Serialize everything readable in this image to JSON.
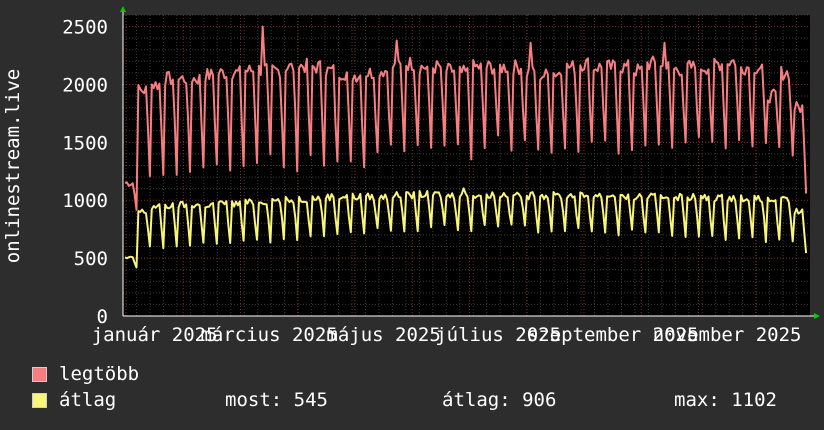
{
  "colors": {
    "background": "#2d2d2d",
    "plot_background": "#000000",
    "grid_minor": "#3a3a3a",
    "grid_major": "#8a2a2a",
    "text": "#ffffff",
    "series_max": "#f77e80",
    "series_avg": "#f8f57a",
    "axis_arrow": "#00cc00"
  },
  "chart_data": {
    "type": "line",
    "ylabel": "onlinestream.live",
    "ylim": [
      0,
      2600
    ],
    "yticks": [
      "0",
      "500",
      "1000",
      "1500",
      "2000",
      "2500"
    ],
    "xticks": [
      "január 2025",
      "március 2025",
      "május 2025",
      "július 2025",
      "szeptember 2025",
      "november 2025"
    ],
    "grid": true,
    "legend_placement": "bottom",
    "series": [
      {
        "name": "legtöbb",
        "color": "#f77e80",
        "weekday_level": [
          1150,
          1950,
          2000,
          2050,
          2050,
          2050,
          2080,
          2100,
          2100,
          2120,
          2130,
          2120,
          2150,
          2160,
          2150,
          2120,
          2100,
          2080,
          2100,
          2120,
          2150,
          2180,
          2150,
          2150,
          2120,
          2100,
          2150,
          2150,
          2150,
          2150,
          2100,
          2080,
          2100,
          2150,
          2180,
          2150,
          2150,
          2150,
          2120,
          2180,
          2150,
          2130,
          2150,
          2150,
          2180,
          2200,
          2150,
          2150,
          1900,
          2100,
          1800
        ],
        "weekend_level": [
          950,
          1250,
          1250,
          1250,
          1250,
          1300,
          1300,
          1300,
          1300,
          1350,
          1350,
          1300,
          1300,
          1350,
          1350,
          1300,
          1300,
          1300,
          1400,
          1450,
          1450,
          1500,
          1450,
          1450,
          1450,
          1400,
          1450,
          1500,
          1450,
          1500,
          1400,
          1450,
          1500,
          1450,
          1500,
          1500,
          1450,
          1450,
          1500,
          1500,
          1450,
          1450,
          1500,
          1450,
          1450,
          1500,
          1450,
          1450,
          1450,
          1400,
          1100
        ],
        "peaks": [
          2500,
          2380,
          2360,
          2360
        ]
      },
      {
        "name": "átlag",
        "color": "#f8f57a",
        "weekday_level": [
          500,
          900,
          940,
          950,
          960,
          960,
          960,
          970,
          970,
          980,
          990,
          1000,
          1000,
          1010,
          1020,
          1030,
          1030,
          1030,
          1030,
          1030,
          1040,
          1040,
          1050,
          1050,
          1040,
          1040,
          1040,
          1050,
          1050,
          1050,
          1040,
          1040,
          1040,
          1040,
          1040,
          1040,
          1040,
          1030,
          1030,
          1030,
          1030,
          1030,
          1030,
          1020,
          1020,
          1020,
          1020,
          1010,
          1000,
          1000,
          900
        ],
        "weekend_level": [
          420,
          600,
          600,
          610,
          610,
          620,
          630,
          640,
          650,
          650,
          660,
          670,
          680,
          690,
          700,
          710,
          720,
          730,
          740,
          750,
          760,
          760,
          770,
          780,
          770,
          760,
          760,
          760,
          760,
          760,
          750,
          750,
          740,
          740,
          730,
          730,
          720,
          720,
          710,
          710,
          700,
          690,
          680,
          680,
          670,
          660,
          660,
          650,
          640,
          630,
          550
        ],
        "peaks": [
          1102
        ]
      }
    ]
  },
  "legend": {
    "items": [
      {
        "label": "legtöbb"
      },
      {
        "label": "átlag"
      }
    ],
    "stats": {
      "most": "most: 545",
      "atlag": "átlag: 906",
      "max": "max: 1102"
    }
  }
}
